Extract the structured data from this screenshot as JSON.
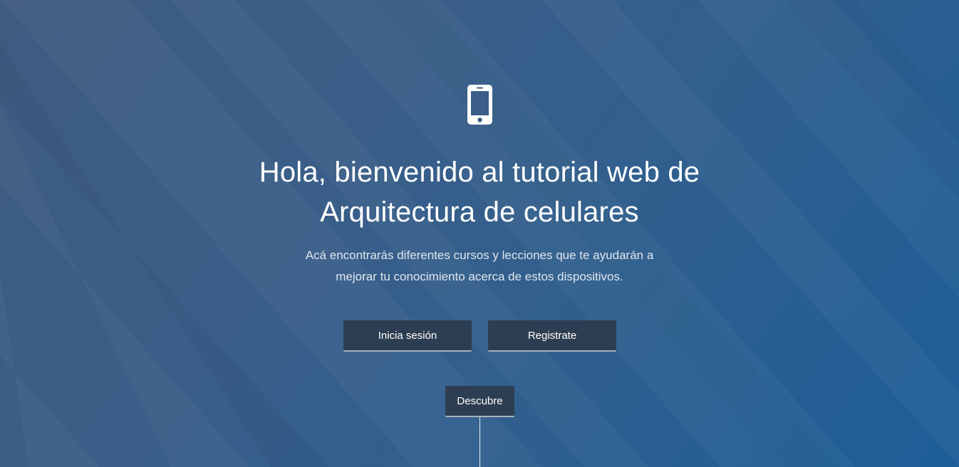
{
  "hero": {
    "icon": "mobile-phone-icon",
    "title": "Hola, bienvenido al tutorial web de Arquitectura de celulares",
    "subtitle": "Acá encontrarás diferentes cursos y lecciones que te ayudarán a mejorar tu conocimiento acerca de estos dispositivos.",
    "buttons": {
      "login": "Inicia sesión",
      "register": "Registrate",
      "discover": "Descubre"
    }
  },
  "colors": {
    "background_start": "#3f5b80",
    "background_end": "#1d5e98",
    "button_bg": "#2d3e52",
    "button_border": "#a9b2bd",
    "text": "#ffffff"
  }
}
